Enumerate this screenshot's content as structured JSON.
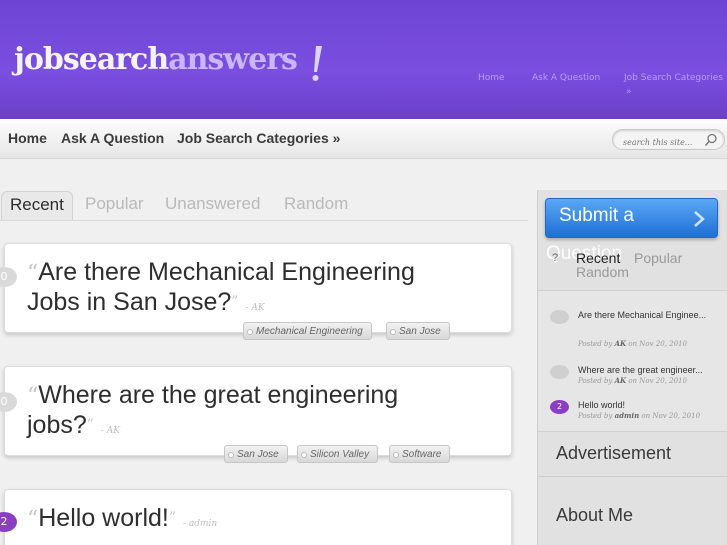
{
  "site": {
    "logo_part1": "jobsearch",
    "logo_part2": "answers",
    "brand_color": "#7a4fe0"
  },
  "top_links": [
    "Home",
    "Ask A Question",
    "Job Search Categories",
    "»"
  ],
  "nav": {
    "items": [
      "Home",
      "Ask A Question",
      "Job Search Categories »"
    ]
  },
  "search": {
    "placeholder": "search this site..."
  },
  "tabs": [
    "Recent",
    "Popular",
    "Unanswered",
    "Random"
  ],
  "questions": [
    {
      "bubble": "0",
      "open_quote": "“",
      "title_line1": "Are there Mechanical Engineering",
      "title_line2": "Jobs in San Jose?",
      "close_quote": "”",
      "author": "- AK",
      "tags": [
        "Mechanical Engineering",
        "San Jose"
      ]
    },
    {
      "bubble": "0",
      "open_quote": "“",
      "title_line1": "Where are the great engineering",
      "title_line2": "jobs?",
      "close_quote": "”",
      "author": "- AK",
      "tags": [
        "San Jose",
        "Silicon Valley",
        "Software"
      ]
    },
    {
      "bubble": "2",
      "open_quote": "“",
      "title_line1": "Hello world!",
      "close_quote": "”",
      "author": "- admin"
    }
  ],
  "sidebar": {
    "submit_label": "Submit a",
    "submit_overflow": "Question",
    "tabs": [
      "Recent",
      "Popular",
      "Random"
    ],
    "tab_icon": "?",
    "recent": [
      {
        "bubble": "",
        "title": "Are there Mechanical Enginee...",
        "posted": "Posted by",
        "author": "AK",
        "on": "on Nov 20, 2010"
      },
      {
        "bubble": "",
        "title": "Where are the great engineer...",
        "posted": "Posted by",
        "author": "AK",
        "on": "on Nov 20, 2010"
      },
      {
        "bubble": "2",
        "title": "Hello world!",
        "posted": "Posted by",
        "author": "admin",
        "on": "on Nov 20, 2010"
      }
    ],
    "widgets": [
      "Advertisement",
      "About Me"
    ]
  }
}
